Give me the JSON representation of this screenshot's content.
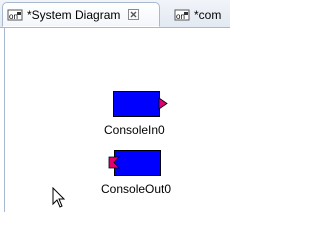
{
  "tabs": [
    {
      "label": "*System Diagram",
      "icon": "rt-system-editor-icon",
      "active": true
    },
    {
      "label": "*com",
      "icon": "rt-system-editor-icon",
      "active": false
    }
  ],
  "components": [
    {
      "name": "ConsoleIn0",
      "port": "outport",
      "port_color": "#e00070",
      "fill": "#0000ff"
    },
    {
      "name": "ConsoleOut0",
      "port": "inport",
      "port_color": "#e00070",
      "fill": "#0000ff"
    }
  ]
}
